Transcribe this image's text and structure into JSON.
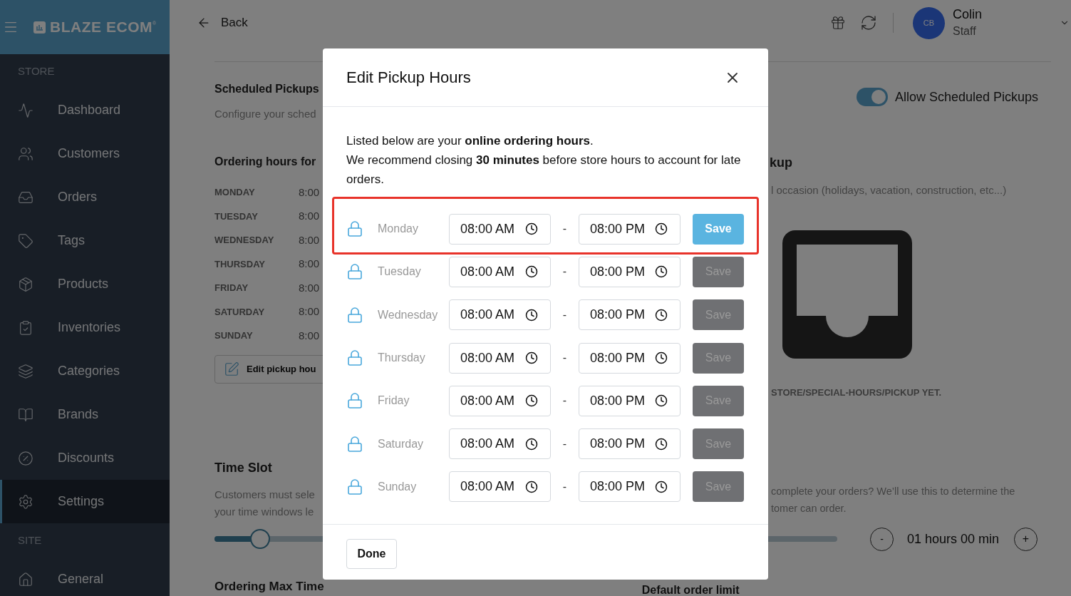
{
  "sidebar": {
    "brand": "BLAZE ECOM",
    "brand_mark": "®",
    "sections": [
      {
        "title": "STORE",
        "items": [
          {
            "label": "Dashboard",
            "selected": false
          },
          {
            "label": "Customers",
            "selected": false
          },
          {
            "label": "Orders",
            "selected": false
          },
          {
            "label": "Tags",
            "selected": false
          },
          {
            "label": "Products",
            "selected": false
          },
          {
            "label": "Inventories",
            "selected": false
          },
          {
            "label": "Categories",
            "selected": false
          },
          {
            "label": "Brands",
            "selected": false
          },
          {
            "label": "Discounts",
            "selected": false
          },
          {
            "label": "Settings",
            "selected": true
          }
        ]
      },
      {
        "title": "SITE",
        "items": [
          {
            "label": "General",
            "selected": false
          }
        ]
      }
    ]
  },
  "topbar": {
    "back": "Back",
    "user": {
      "initials": "CB",
      "name": "Colin",
      "role": "Staff"
    }
  },
  "page": {
    "scheduled_pickups": {
      "title": "Scheduled Pickups",
      "subtitle": "Configure your sched",
      "toggle": {
        "label": "Allow Scheduled Pickups",
        "on": true
      }
    },
    "ordering_hours": {
      "title": "Ordering hours for",
      "days": [
        {
          "day": "MONDAY",
          "time": "8:00"
        },
        {
          "day": "TUESDAY",
          "time": "8:00"
        },
        {
          "day": "WEDNESDAY",
          "time": "8:00"
        },
        {
          "day": "THURSDAY",
          "time": "8:00"
        },
        {
          "day": "FRIDAY",
          "time": "8:00"
        },
        {
          "day": "SATURDAY",
          "time": "8:00"
        },
        {
          "day": "SUNDAY",
          "time": "8:00"
        }
      ],
      "edit_button": "Edit pickup hou"
    },
    "special_hours": {
      "title": "kup",
      "description": "l occasion (holidays, vacation, construction, etc...)",
      "empty_message": "STORE/SPECIAL-HOURS/PICKUP YET."
    },
    "time_slot": {
      "title": "Time Slot",
      "description_left": [
        "Customers must sele",
        "your time windows le"
      ],
      "description_right": [
        "complete your orders? We’ll use this to determine the",
        "tomer can order."
      ],
      "slider": {
        "level": 0.073
      },
      "stepper": {
        "minus": "-",
        "value": "01 hours 00 min",
        "plus": "+"
      }
    },
    "ordering_max_time": {
      "title": "Ordering Max Time"
    },
    "default_order_limit": {
      "title": "Default order limit"
    }
  },
  "modal": {
    "title": "Edit Pickup Hours",
    "intro": [
      "Listed below are your **online ordering hours**.",
      "We recommend closing **30 minutes** before store hours to account for late orders."
    ],
    "rows": [
      {
        "day": "Monday",
        "start": "08:00 AM",
        "separator": "-",
        "end": "08:00 PM",
        "save": "Save",
        "save_enabled": true,
        "highlighted": true
      },
      {
        "day": "Tuesday",
        "start": "08:00 AM",
        "separator": "-",
        "end": "08:00 PM",
        "save": "Save",
        "save_enabled": false,
        "highlighted": false
      },
      {
        "day": "Wednesday",
        "start": "08:00 AM",
        "separator": "-",
        "end": "08:00 PM",
        "save": "Save",
        "save_enabled": false,
        "highlighted": false
      },
      {
        "day": "Thursday",
        "start": "08:00 AM",
        "separator": "-",
        "end": "08:00 PM",
        "save": "Save",
        "save_enabled": false,
        "highlighted": false
      },
      {
        "day": "Friday",
        "start": "08:00 AM",
        "separator": "-",
        "end": "08:00 PM",
        "save": "Save",
        "save_enabled": false,
        "highlighted": false
      },
      {
        "day": "Saturday",
        "start": "08:00 AM",
        "separator": "-",
        "end": "08:00 PM",
        "save": "Save",
        "save_enabled": false,
        "highlighted": false
      },
      {
        "day": "Sunday",
        "start": "08:00 AM",
        "separator": "-",
        "end": "08:00 PM",
        "save": "Save",
        "save_enabled": false,
        "highlighted": false
      }
    ],
    "done": "Done"
  }
}
